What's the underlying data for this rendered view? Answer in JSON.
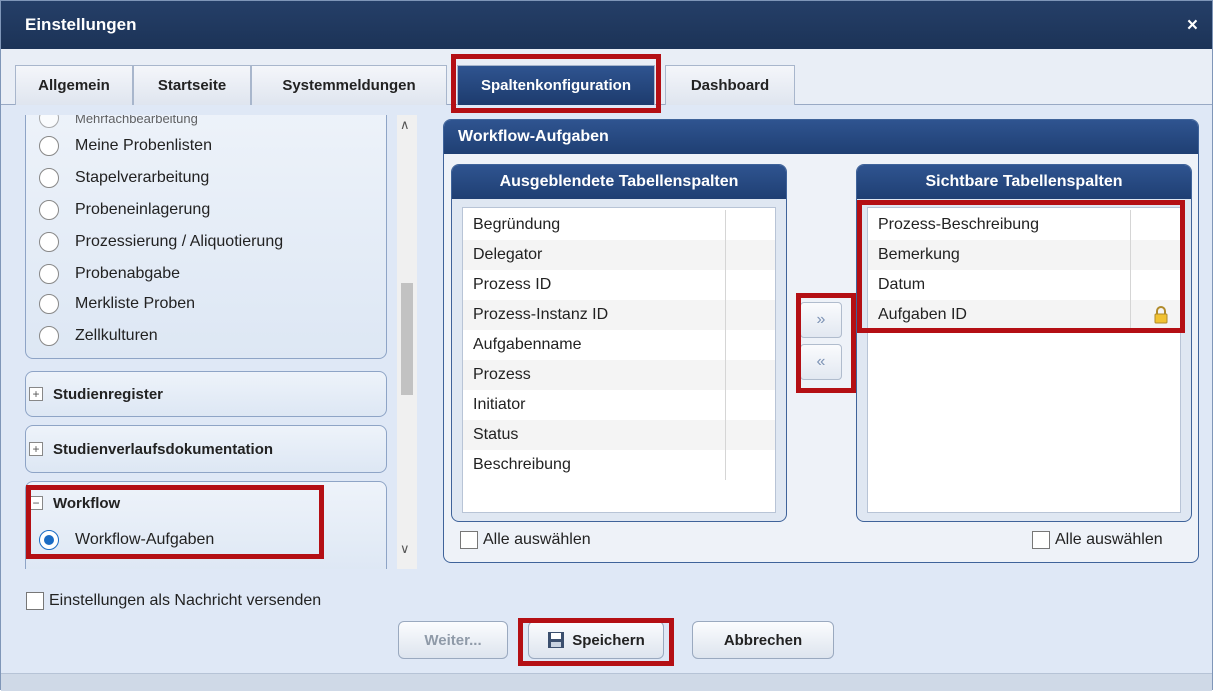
{
  "dialog": {
    "title": "Einstellungen",
    "close": "×"
  },
  "tabs": [
    {
      "label": "Allgemein"
    },
    {
      "label": "Startseite"
    },
    {
      "label": "Systemmeldungen"
    },
    {
      "label": "Spaltenkonfiguration"
    },
    {
      "label": "Dashboard"
    }
  ],
  "left": {
    "cut_item": "Mehrfachbearbeitung",
    "items": [
      {
        "label": "Meine Probenlisten"
      },
      {
        "label": "Stapelverarbeitung"
      },
      {
        "label": "Probeneinlagerung"
      },
      {
        "label": "Prozessierung / Aliquotierung"
      },
      {
        "label": "Probenabgabe"
      },
      {
        "label": "Merkliste Proben"
      },
      {
        "label": "Zellkulturen"
      }
    ],
    "groups": [
      {
        "label": "Studienregister",
        "toggle": "+"
      },
      {
        "label": "Studienverlaufsdokumentation",
        "toggle": "+"
      },
      {
        "label": "Workflow",
        "toggle": "−"
      }
    ],
    "workflow_item": "Workflow-Aufgaben"
  },
  "right": {
    "title": "Workflow-Aufgaben",
    "hidden_title": "Ausgeblendete Tabellenspalten",
    "visible_title": "Sichtbare Tabellenspalten",
    "hidden_items": [
      "Begründung",
      "Delegator",
      "Prozess ID",
      "Prozess-Instanz ID",
      "Aufgabenname",
      "Prozess",
      "Initiator",
      "Status",
      "Beschreibung"
    ],
    "visible_items": [
      "Prozess-Beschreibung",
      "Bemerkung",
      "Datum",
      "Aufgaben ID"
    ],
    "move_right": "»",
    "move_left": "«",
    "select_all": "Alle auswählen"
  },
  "footer": {
    "send_message": "Einstellungen als Nachricht versenden",
    "next": "Weiter...",
    "save": "Speichern",
    "cancel": "Abbrechen"
  }
}
